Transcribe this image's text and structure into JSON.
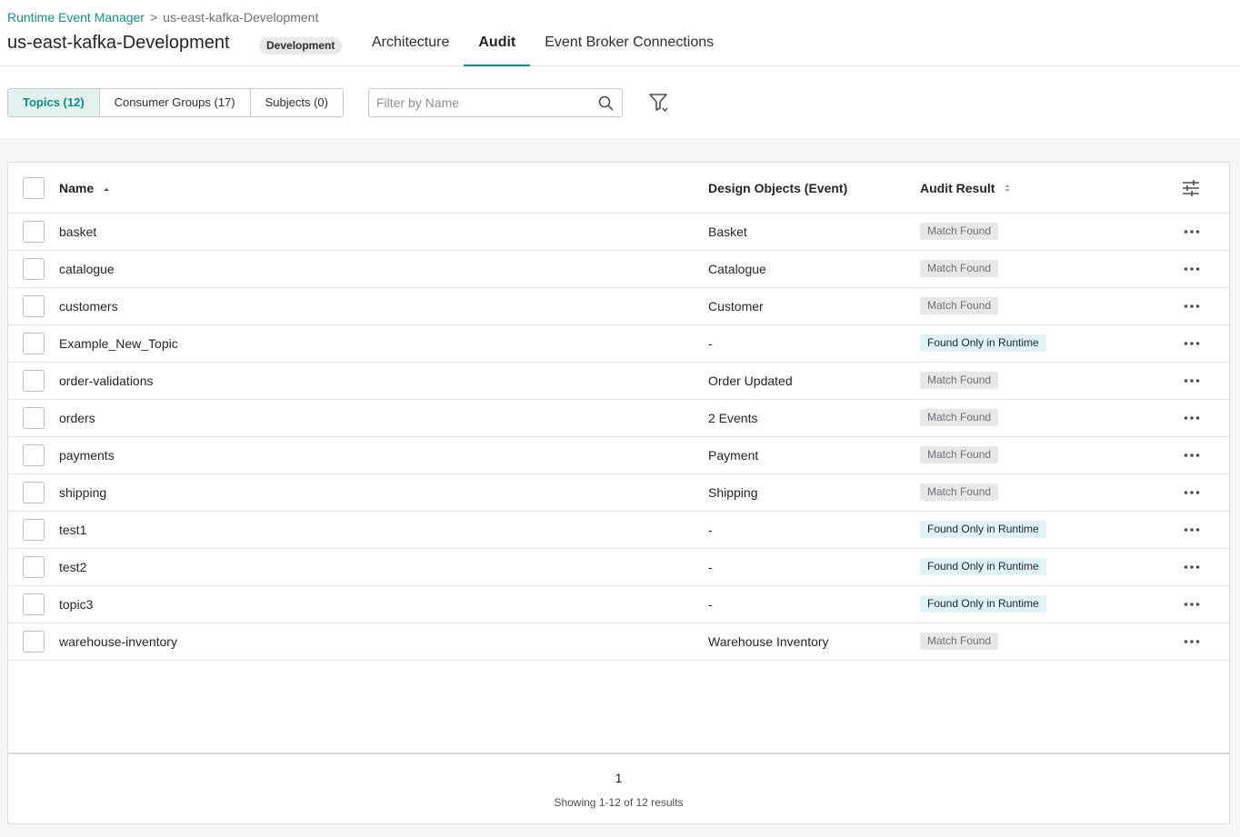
{
  "breadcrumb": {
    "root": "Runtime Event Manager",
    "separator": ">",
    "current": "us-east-kafka-Development"
  },
  "header": {
    "title": "us-east-kafka-Development",
    "environment_badge": "Development",
    "tabs": [
      {
        "label": "Architecture",
        "active": false
      },
      {
        "label": "Audit",
        "active": true
      },
      {
        "label": "Event Broker Connections",
        "active": false
      }
    ]
  },
  "toolbar": {
    "segments": [
      {
        "label": "Topics (12)",
        "active": true
      },
      {
        "label": "Consumer Groups (17)",
        "active": false
      },
      {
        "label": "Subjects (0)",
        "active": false
      }
    ],
    "search_placeholder": "Filter by Name"
  },
  "table": {
    "columns": {
      "name": "Name",
      "design": "Design Objects (Event)",
      "audit": "Audit Result"
    },
    "rows": [
      {
        "name": "basket",
        "design": "Basket",
        "audit": "Match Found",
        "audit_type": "match"
      },
      {
        "name": "catalogue",
        "design": "Catalogue",
        "audit": "Match Found",
        "audit_type": "match"
      },
      {
        "name": "customers",
        "design": "Customer",
        "audit": "Match Found",
        "audit_type": "match"
      },
      {
        "name": "Example_New_Topic",
        "design": "-",
        "audit": "Found Only in Runtime",
        "audit_type": "runtime"
      },
      {
        "name": "order-validations",
        "design": "Order Updated",
        "audit": "Match Found",
        "audit_type": "match"
      },
      {
        "name": "orders",
        "design": "2 Events",
        "audit": "Match Found",
        "audit_type": "match"
      },
      {
        "name": "payments",
        "design": "Payment",
        "audit": "Match Found",
        "audit_type": "match"
      },
      {
        "name": "shipping",
        "design": "Shipping",
        "audit": "Match Found",
        "audit_type": "match"
      },
      {
        "name": "test1",
        "design": "-",
        "audit": "Found Only in Runtime",
        "audit_type": "runtime"
      },
      {
        "name": "test2",
        "design": "-",
        "audit": "Found Only in Runtime",
        "audit_type": "runtime"
      },
      {
        "name": "topic3",
        "design": "-",
        "audit": "Found Only in Runtime",
        "audit_type": "runtime"
      },
      {
        "name": "warehouse-inventory",
        "design": "Warehouse Inventory",
        "audit": "Match Found",
        "audit_type": "match"
      }
    ]
  },
  "pagination": {
    "page": "1",
    "summary": "Showing 1-12 of 12 results"
  },
  "colors": {
    "accent": "#0d9488",
    "match_badge_bg": "#e6e7e8",
    "runtime_badge_bg": "#def4f8"
  }
}
